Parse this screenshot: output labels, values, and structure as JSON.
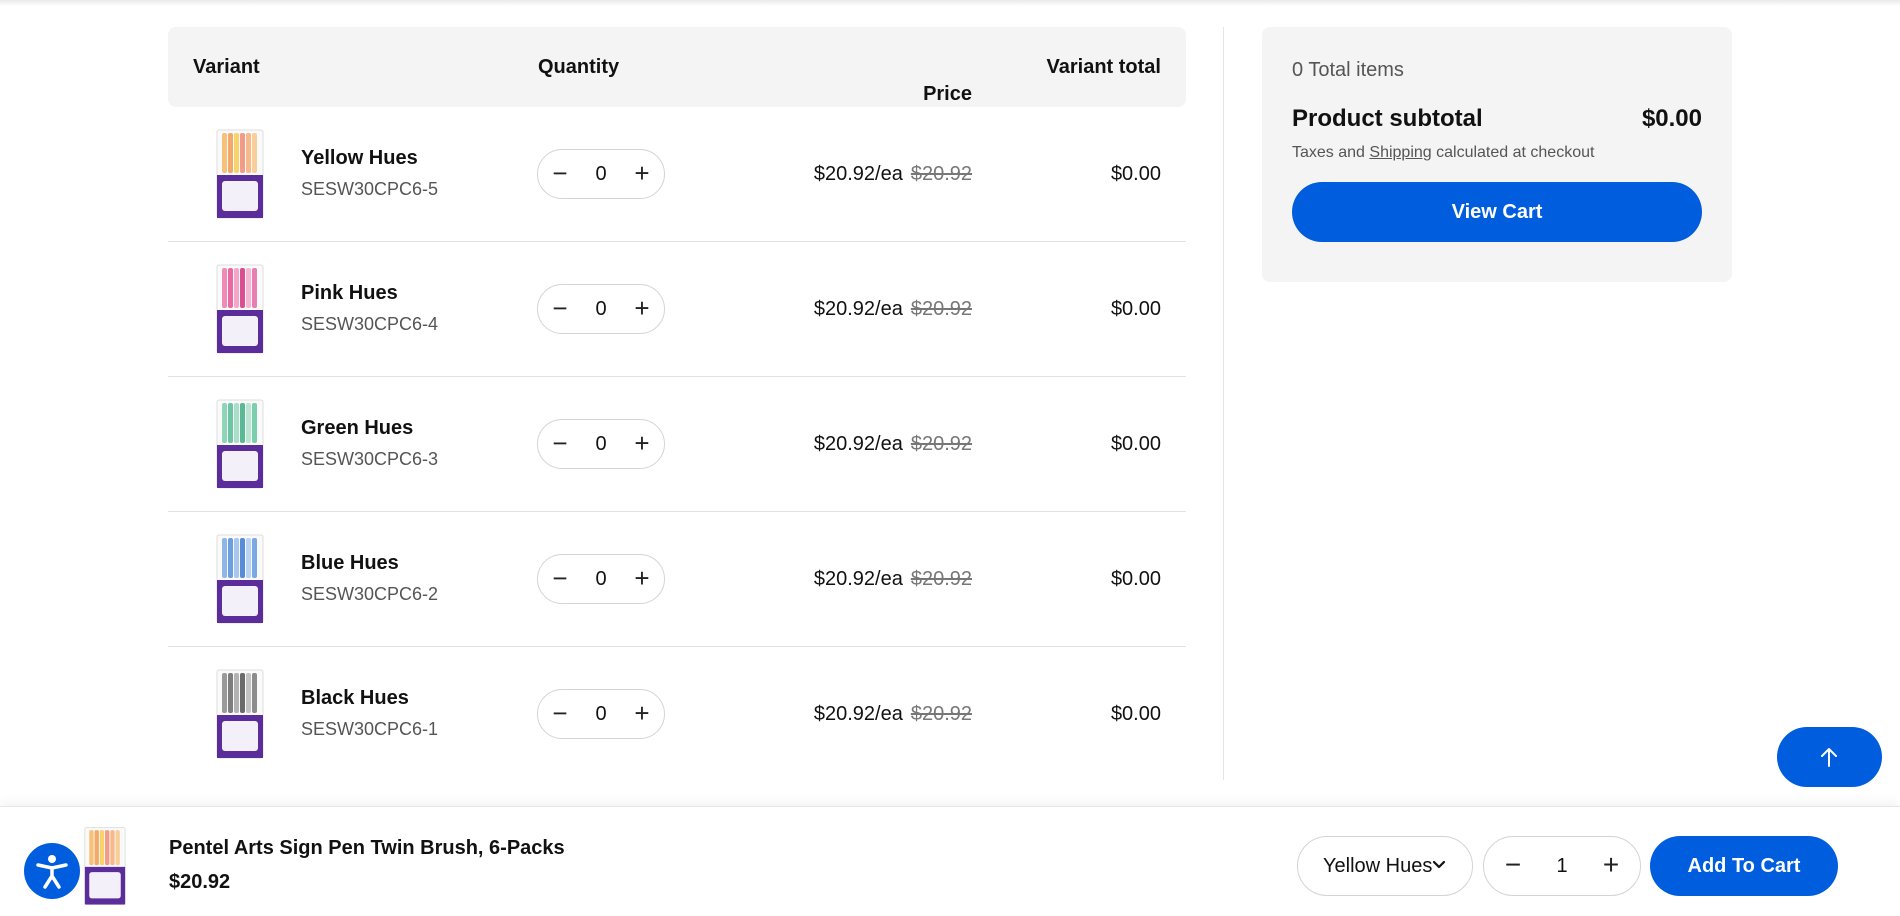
{
  "table": {
    "headers": {
      "variant": "Variant",
      "quantity": "Quantity",
      "price": "Price",
      "variant_total": "Variant total"
    },
    "rows": [
      {
        "name": "Yellow Hues",
        "sku": "SESW30CPC6-5",
        "qty": "0",
        "price": "$20.92/ea",
        "compare_price": "$20.92",
        "total": "$0.00",
        "icon": "marker-pack-image"
      },
      {
        "name": "Pink Hues",
        "sku": "SESW30CPC6-4",
        "qty": "0",
        "price": "$20.92/ea",
        "compare_price": "$20.92",
        "total": "$0.00",
        "icon": "marker-pack-image"
      },
      {
        "name": "Green Hues",
        "sku": "SESW30CPC6-3",
        "qty": "0",
        "price": "$20.92/ea",
        "compare_price": "$20.92",
        "total": "$0.00",
        "icon": "marker-pack-image"
      },
      {
        "name": "Blue Hues",
        "sku": "SESW30CPC6-2",
        "qty": "0",
        "price": "$20.92/ea",
        "compare_price": "$20.92",
        "total": "$0.00",
        "icon": "marker-pack-image"
      },
      {
        "name": "Black Hues",
        "sku": "SESW30CPC6-1",
        "qty": "0",
        "price": "$20.92/ea",
        "compare_price": "$20.92",
        "total": "$0.00",
        "icon": "marker-pack-image"
      }
    ]
  },
  "summary": {
    "total_items": "0 Total items",
    "subtotal_label": "Product subtotal",
    "subtotal_value": "$0.00",
    "tax_prefix": "Taxes and",
    "tax_link": "Shipping",
    "tax_suffix": "calculated at checkout",
    "view_cart_label": "View Cart"
  },
  "sticky_bar": {
    "product_name": "Pentel Arts Sign Pen Twin Brush, 6-Packs",
    "price": "$20.92",
    "selected_variant": "Yellow Hues",
    "quantity": "1",
    "add_to_cart_label": "Add To Cart"
  },
  "colors": {
    "accent": "#005ddd",
    "panel": "#f4f4f4",
    "border": "#e2e2e2"
  }
}
